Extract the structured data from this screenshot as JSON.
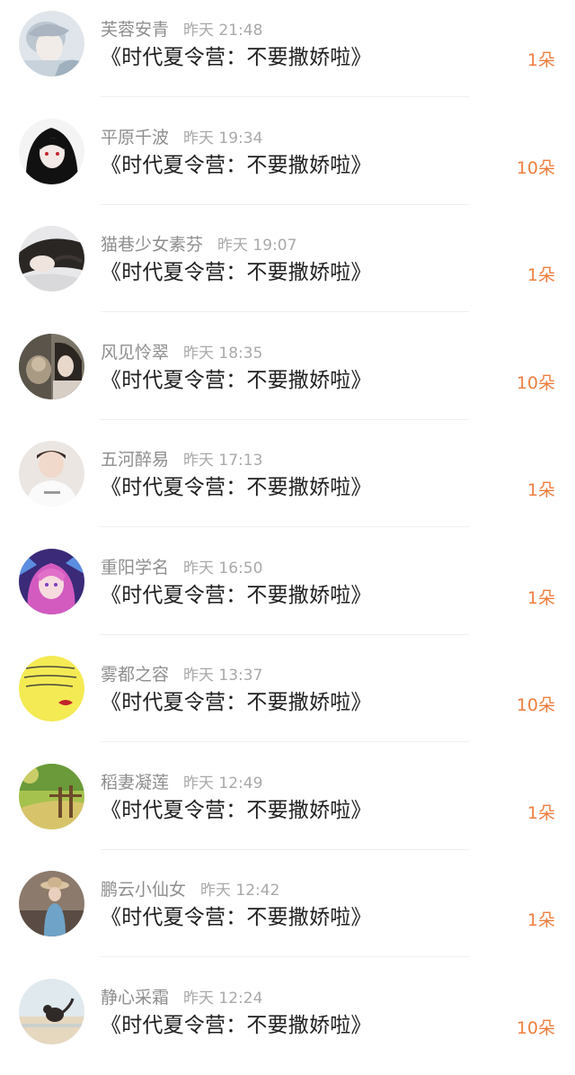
{
  "gifts": [
    {
      "name": "芙蓉安青",
      "time": "昨天 21:48",
      "message": "《时代夏令营：不要撒娇啦》",
      "count": "1朵",
      "avatar": "avatar-pale-boy"
    },
    {
      "name": "平原千波",
      "time": "昨天 19:34",
      "message": "《时代夏令营：不要撒娇啦》",
      "count": "10朵",
      "avatar": "avatar-dark-girl"
    },
    {
      "name": "猫巷少女素芬",
      "time": "昨天 19:07",
      "message": "《时代夏令营：不要撒娇啦》",
      "count": "1朵",
      "avatar": "avatar-sleeping-girl"
    },
    {
      "name": "风见怜翠",
      "time": "昨天 18:35",
      "message": "《时代夏令营：不要撒娇啦》",
      "count": "10朵",
      "avatar": "avatar-girl-with-monkey"
    },
    {
      "name": "五河醉易",
      "time": "昨天 17:13",
      "message": "《时代夏令营：不要撒娇啦》",
      "count": "1朵",
      "avatar": "avatar-boy-white-shirt"
    },
    {
      "name": "重阳学名",
      "time": "昨天 16:50",
      "message": "《时代夏令营：不要撒娇啦》",
      "count": "1朵",
      "avatar": "avatar-anime-pink-hair"
    },
    {
      "name": "雾都之容",
      "time": "昨天 13:37",
      "message": "《时代夏令营：不要撒娇啦》",
      "count": "10朵",
      "avatar": "avatar-yellow-note-lips"
    },
    {
      "name": "稻妻凝莲",
      "time": "昨天 12:49",
      "message": "《时代夏令营：不要撒娇啦》",
      "count": "1朵",
      "avatar": "avatar-green-fence-scene"
    },
    {
      "name": "鹏云小仙女",
      "time": "昨天 12:42",
      "message": "《时代夏令营：不要撒娇啦》",
      "count": "1朵",
      "avatar": "avatar-girl-straw-hat"
    },
    {
      "name": "静心采霜",
      "time": "昨天 12:24",
      "message": "《时代夏令营：不要撒娇啦》",
      "count": "10朵",
      "avatar": "avatar-cat-on-sand"
    }
  ]
}
